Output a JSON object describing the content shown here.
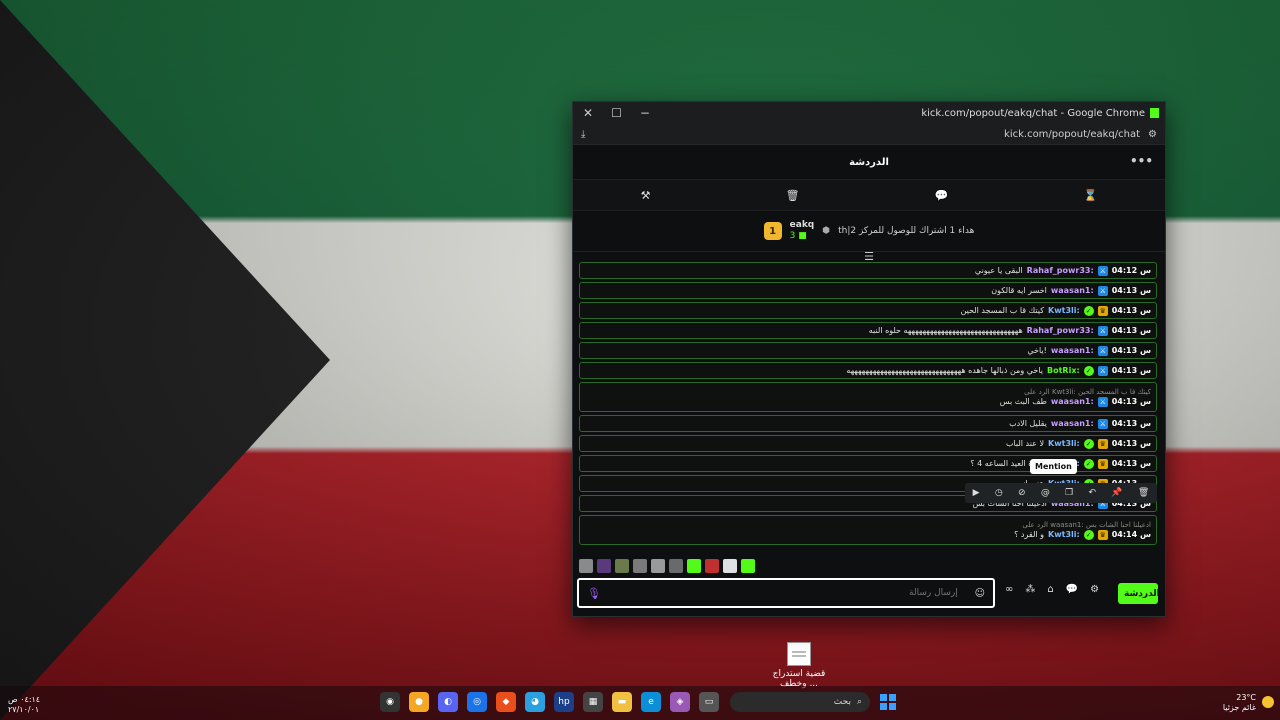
{
  "window": {
    "title": "kick.com/popout/eakq/chat - Google Chrome",
    "url": "kick.com/popout/eakq/chat",
    "minimize_icon": "−",
    "maximize_icon": "☐",
    "close_icon": "✕"
  },
  "chat": {
    "header_title": "الدردشة",
    "more_icon": "•••",
    "mod_tools": [
      "hourglass-icon",
      "chat-bubble-icon",
      "trash-icon",
      "hammer-icon"
    ],
    "pinned": {
      "rank": "1",
      "username": "eakq",
      "count": "3",
      "gift_text": "th|هداء 1 اشتراك للوصول للمركز 2"
    },
    "messages": [
      {
        "time": "04:12 س",
        "user": "Rahaf_powr33:",
        "user_color": "#c79dff",
        "badge": "mod",
        "text": "البقى يا عيوني"
      },
      {
        "time": "04:13 س",
        "user": "waasan1:",
        "user_color": "#c79dff",
        "badge": "mod",
        "text": "اخسر ايه قالكون"
      },
      {
        "time": "04:13 س",
        "user": "Kwt3li:",
        "user_color": "#7fb8ff",
        "badge": "crown",
        "text": "كيتك قا ب المسجد الحين"
      },
      {
        "time": "04:13 س",
        "user": "Rahaf_powr33:",
        "user_color": "#c79dff",
        "badge": "mod",
        "text": "هههههههههههههههههههههههههههههههه حلوه النبه"
      },
      {
        "time": "04:13 س",
        "user": "waasan1:",
        "user_color": "#c79dff",
        "badge": "mod",
        "text": "ياخي!"
      },
      {
        "time": "04:13 س",
        "user": "BotRix:",
        "user_color": "#53fc18",
        "badge": "mod",
        "text": "ياخي ومن ذبالها جاهده هههههههههههههههههههههههههههههههه"
      },
      {
        "time": "04:13 س",
        "user": "waasan1:",
        "user_color": "#c79dff",
        "badge": "mod",
        "text": "طف البث بس",
        "reply": "الرد على Kwt3li: كيتك قا ب المسجد الحين"
      },
      {
        "time": "04:13 س",
        "user": "waasan1:",
        "user_color": "#c79dff",
        "badge": "mod",
        "text": "يقليل الادب"
      },
      {
        "time": "04:13 س",
        "user": "Kwt3li:",
        "user_color": "#7fb8ff",
        "badge": "crown",
        "text": "لا عند الباب"
      },
      {
        "time": "04:13 س",
        "user": "Kwt3li:",
        "user_color": "#7fb8ff",
        "badge": "crown",
        "text": "صلاة العيد الساعه 4 ؟"
      },
      {
        "time": "04:13 س",
        "user": "Kwt3li:",
        "user_color": "#7fb8ff",
        "badge": "crown",
        "text": "عني انت"
      },
      {
        "time": "04:13 س",
        "user": "waasan1:",
        "user_color": "#c79dff",
        "badge": "mod",
        "text": "ادعيلنا احنا الشات بس"
      },
      {
        "time": "04:14 س",
        "user": "Kwt3li:",
        "user_color": "#7fb8ff",
        "badge": "crown",
        "text": "و القرد ؟",
        "reply": "الرد على waasan1: ادعيلنا احنا الشات بس"
      }
    ],
    "tooltip": "Mention",
    "actions": [
      "trash-icon",
      "pin-icon",
      "reply-icon",
      "copy-icon",
      "mention-icon",
      "slash-icon",
      "clock-icon",
      "play-icon"
    ],
    "emote_colors": [
      "#8a8a8a",
      "#5a3a7a",
      "#6b7a4a",
      "#7a7a7a",
      "#9a9a9a",
      "#6a6a6a",
      "#53fc18",
      "#c03030",
      "#e0e0e0",
      "#53fc18"
    ],
    "input_placeholder": "إرسال رسالة",
    "send_label": "الدردشة"
  },
  "desktop": {
    "icon_label": "قضية استدراج وخطف ..."
  },
  "taskbar": {
    "search_placeholder": "بحث",
    "weather_temp": "23°C",
    "weather_text": "غائم جزئيا",
    "time": "٠٤:١٤ ص",
    "date": "٢٧/١٠/٠١"
  }
}
